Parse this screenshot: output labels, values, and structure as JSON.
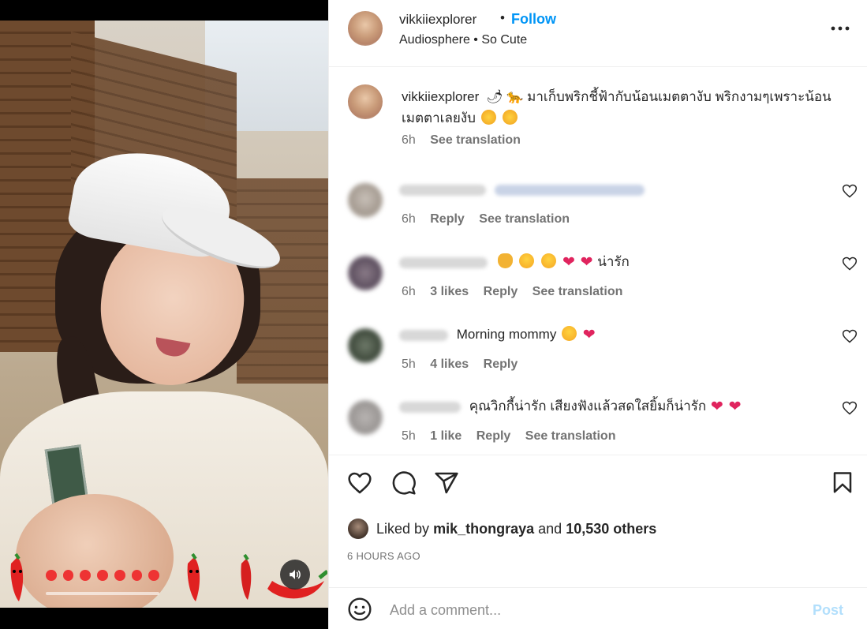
{
  "post": {
    "username": "vikkiiexplorer",
    "follow_label": "Follow",
    "audio": "Audiosphere",
    "audio_track": "So Cute",
    "caption_username": "vikkiiexplorer",
    "caption_text": "🌶 🐆 มาเก็บพริกชี้ฟ้ากับน้อนเมตตางับ พริกงามๆเพราะน้อนเมตตาเลยงับ",
    "caption_time": "6h",
    "caption_translate": "See translation"
  },
  "comments": [
    {
      "text": "",
      "time": "6h",
      "likes": "",
      "reply": "Reply",
      "translate": "See translation"
    },
    {
      "text": "น่ารัก",
      "time": "6h",
      "likes": "3 likes",
      "reply": "Reply",
      "translate": "See translation"
    },
    {
      "text": "Morning mommy",
      "time": "5h",
      "likes": "4 likes",
      "reply": "Reply",
      "translate": ""
    },
    {
      "text": "คุณวิกกี้น่ารัก เสียงฟังแล้วสดใสยิ้มก็น่ารัก",
      "time": "5h",
      "likes": "1 like",
      "reply": "Reply",
      "translate": "See translation"
    }
  ],
  "likes": {
    "prefix": "Liked by",
    "user": "mik_thongraya",
    "and": "and",
    "others": "10,530 others"
  },
  "timestamp": "6 HOURS AGO",
  "add_comment": {
    "placeholder": "Add a comment...",
    "post_label": "Post"
  },
  "icons": [
    "heart-icon",
    "comment-icon",
    "share-icon",
    "bookmark-icon",
    "more-icon",
    "speaker-icon",
    "emoji-icon"
  ],
  "colors": {
    "accent": "#0095f6",
    "post_disabled": "#b2dffc",
    "muted": "#737373",
    "heart": "#e0245e"
  }
}
